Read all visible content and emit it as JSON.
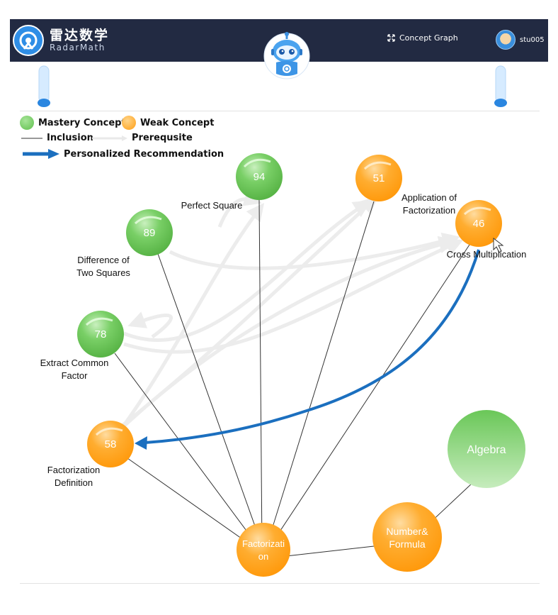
{
  "app": {
    "logo_cn": "雷达数学",
    "logo_en": "RadarMath",
    "nav_concept_graph": "Concept Graph",
    "user_name": "stu005"
  },
  "legend": {
    "mastery": "Mastery Concept",
    "weak": "Weak Concept",
    "inclusion": "Inclusion",
    "prerequisite": "Prerequsite",
    "recommendation": "Personalized Recommendation"
  },
  "colors": {
    "mastery": "#6cc95a",
    "weak": "#ffa31a",
    "recommendation": "#1b6fbf",
    "navbar": "#222a42"
  },
  "nodes": {
    "perfect_square": {
      "score": "94",
      "label": "Perfect Square",
      "status": "mastery"
    },
    "application": {
      "score": "51",
      "label": "Application of Factorization",
      "status": "weak"
    },
    "cross_mult": {
      "score": "46",
      "label": "Cross Multiplication",
      "status": "weak"
    },
    "diff_squares": {
      "score": "89",
      "label": "Difference of Two Squares",
      "status": "mastery"
    },
    "extract_common": {
      "score": "78",
      "label": "Extract Common Factor",
      "status": "mastery"
    },
    "fact_def": {
      "score": "58",
      "label": "Factorization Definition",
      "status": "weak"
    },
    "factorization": {
      "label": "Factorization",
      "status": "weak"
    },
    "number_formula": {
      "label": "Number& Formula",
      "status": "weak"
    },
    "algebra": {
      "label": "Algebra",
      "status": "mastery"
    }
  }
}
